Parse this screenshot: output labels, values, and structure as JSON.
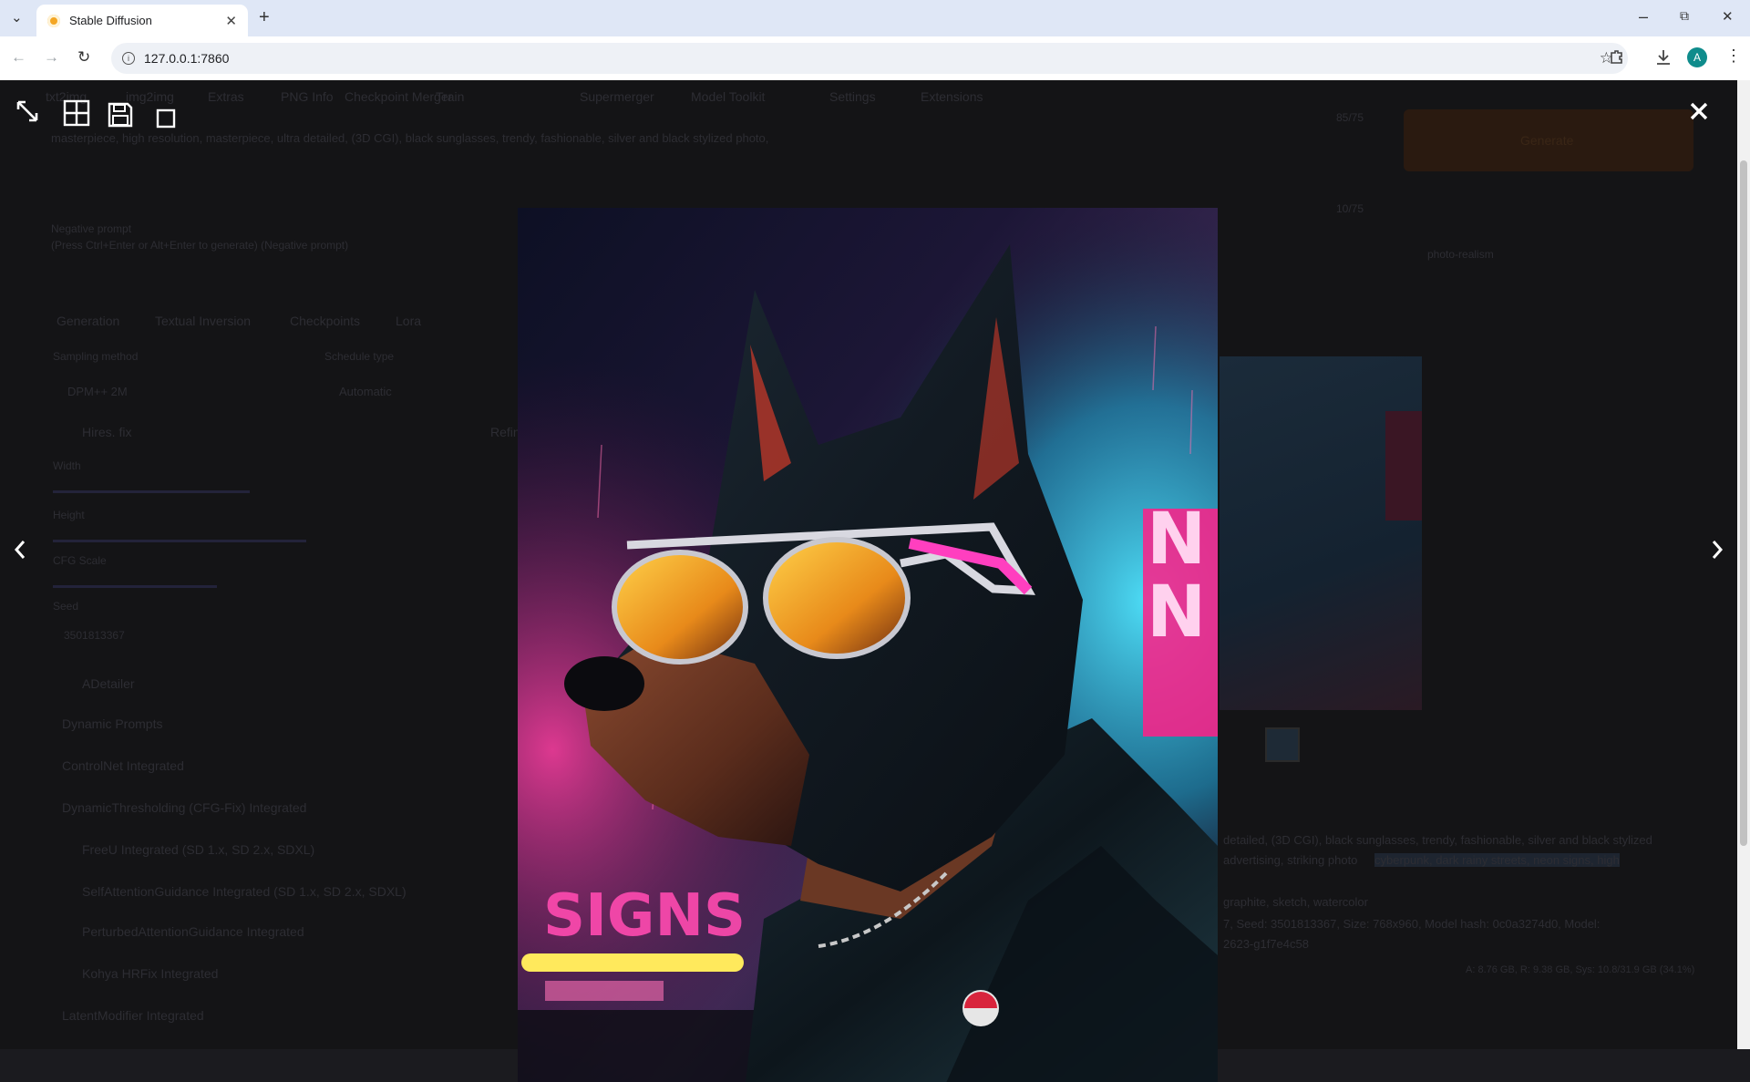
{
  "browser": {
    "tab_title": "Stable Diffusion",
    "url": "127.0.0.1:7860",
    "profile_initial": "A"
  },
  "app_background": {
    "top_tabs": [
      "txt2img",
      "img2img",
      "Extras",
      "PNG Info",
      "Checkpoint Merger",
      "Train",
      "Supermerger",
      "Model Toolkit",
      "Settings",
      "Extensions"
    ],
    "prompt_text": "masterpiece, high resolution, masterpiece, ultra detailed, (3D CGI), black sunglasses, trendy, fashionable, silver and black stylized photo,",
    "negative_label": "Negative prompt",
    "negative_text": "(Press Ctrl+Enter or Alt+Enter to generate) (Negative prompt)",
    "token_count_1": "85/75",
    "token_count_2": "10/75",
    "generate_label": "Generate",
    "style_chip": "photo-realism",
    "sub_tabs": [
      "Generation",
      "Textual Inversion",
      "Checkpoints",
      "Lora"
    ],
    "sampling_label": "Sampling method",
    "sampling_value": "DPM++ 2M",
    "schedule_label": "Schedule type",
    "schedule_value": "Automatic",
    "hires_label": "Hires. fix",
    "refiner_label": "Refiner",
    "width_label": "Width",
    "height_label": "Height",
    "cfg_label": "CFG Scale",
    "seed_label": "Seed",
    "seed_value": "3501813367",
    "accordions": [
      "ADetailer",
      "Dynamic Prompts",
      "ControlNet Integrated",
      "DynamicThresholding (CFG-Fix) Integrated",
      "FreeU Integrated (SD 1.x, SD 2.x, SDXL)",
      "SelfAttentionGuidance Integrated (SD 1.x, SD 2.x, SDXL)",
      "PerturbedAttentionGuidance Integrated",
      "Kohya HRFix Integrated",
      "LatentModifier Integrated"
    ],
    "info_line_1": "detailed, (3D CGI), black sunglasses, trendy, fashionable, silver and black stylized",
    "info_line_2": "advertising, striking photo",
    "info_highlight": "cyberpunk, dark rainy streets, neon signs, high",
    "info_line_3": "graphite, sketch, watercolor",
    "info_line_4": "7, Seed: 3501813367, Size: 768x960, Model hash: 0c0a3274d0, Model:",
    "info_line_5": "2623-g1f7e4c58",
    "vram_text": "A: 8.76 GB, R: 9.38 GB, Sys: 10.8/31.9 GB (34.1%)"
  },
  "lightbox": {
    "fullscreen_icon": "expand-diagonal-icon",
    "tile_icon": "grid-tile-icon",
    "save_icon": "floppy-disk-icon",
    "zoom_icon": "square-icon",
    "close_icon": "close-x-icon",
    "prev_icon": "chevron-left-icon",
    "next_icon": "chevron-right-icon",
    "neon_sign_text": "SIGNS",
    "neon_side_text": "N"
  },
  "colors": {
    "accent_neon_pink": "#ff2ba6",
    "accent_neon_cyan": "#1ec9e8",
    "generate_orange": "#ef6c00"
  }
}
